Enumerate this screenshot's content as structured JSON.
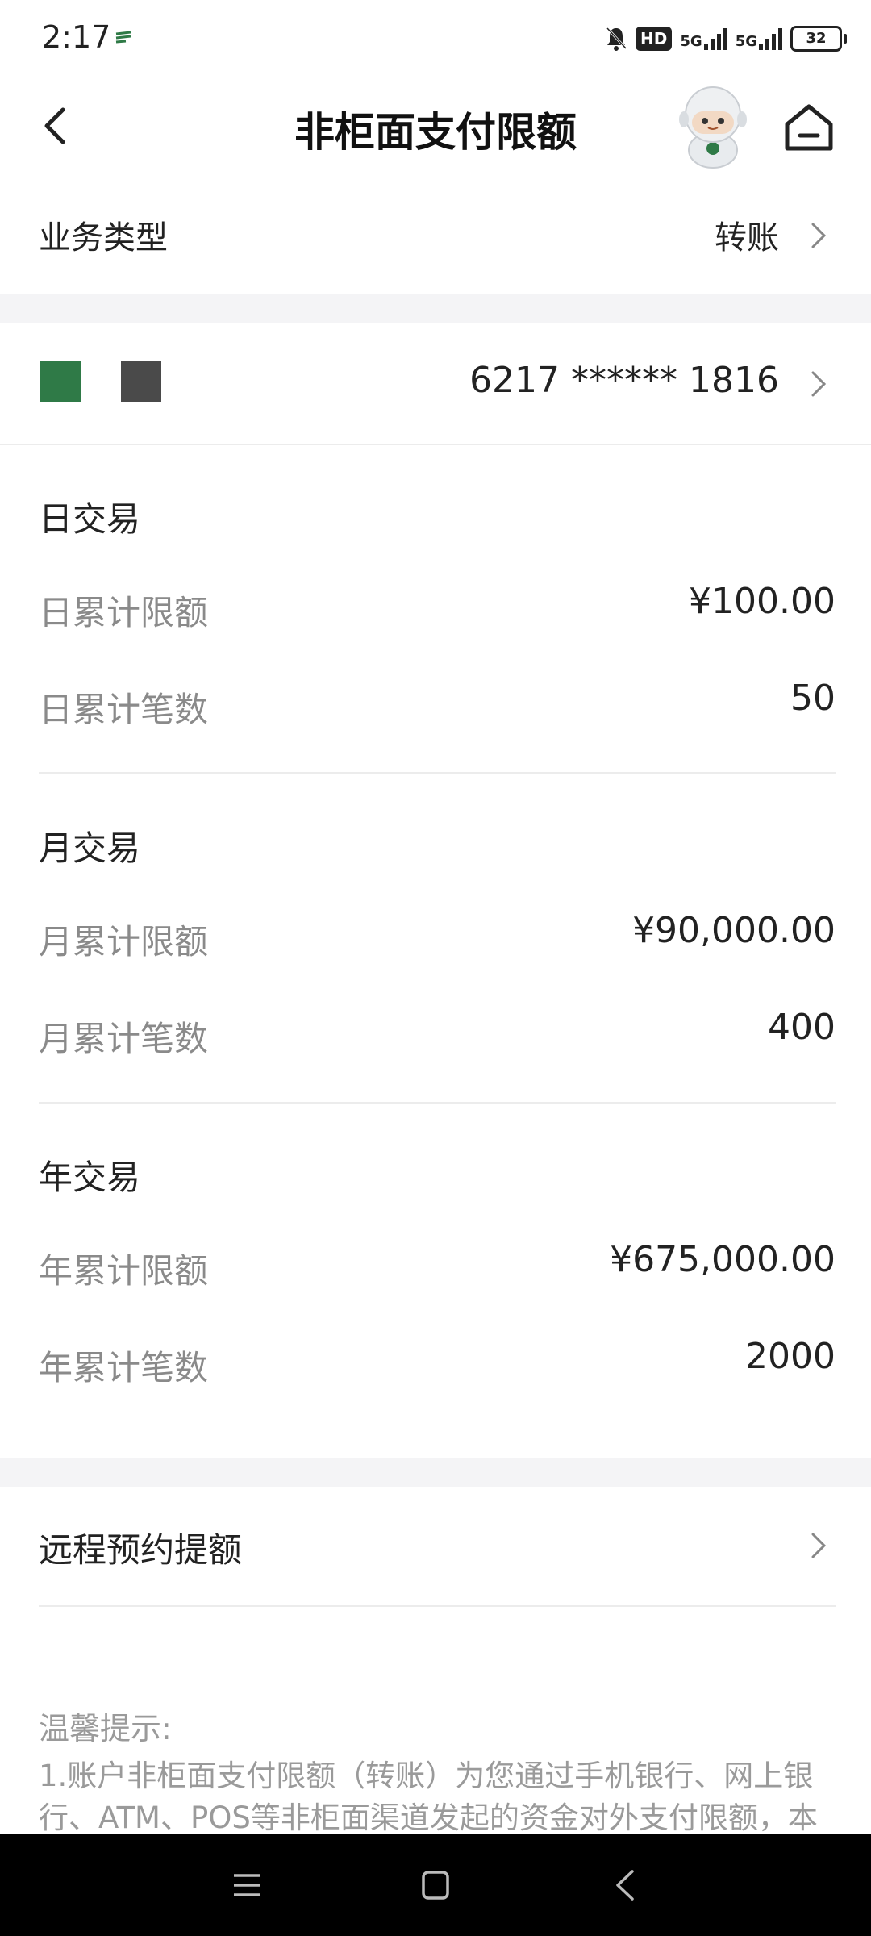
{
  "status_bar": {
    "time": "2:17",
    "hd_label": "HD",
    "net1": "5G",
    "net2": "5G",
    "battery": "32"
  },
  "header": {
    "title": "非柜面支付限额"
  },
  "business_type": {
    "label": "业务类型",
    "value": "转账"
  },
  "account": {
    "card_number": "6217 ****** 1816"
  },
  "daily": {
    "title": "日交易",
    "limit_label": "日累计限额",
    "limit_value": "¥100.00",
    "count_label": "日累计笔数",
    "count_value": "50"
  },
  "monthly": {
    "title": "月交易",
    "limit_label": "月累计限额",
    "limit_value": "¥90,000.00",
    "count_label": "月累计笔数",
    "count_value": "400"
  },
  "yearly": {
    "title": "年交易",
    "limit_label": "年累计限额",
    "limit_value": "¥675,000.00",
    "count_label": "年累计笔数",
    "count_value": "2000"
  },
  "remote": {
    "label": "远程预约提额"
  },
  "tips": {
    "title": "温馨提示:",
    "text": "1.账户非柜面支付限额（转账）为您通过手机银行、网上银行、ATM、POS等非柜面渠道发起的资金对外支付限额，本"
  },
  "colors": {
    "accent_green": "#2f7a47",
    "divider": "#ececec",
    "muted_text": "#8a8a8a"
  }
}
